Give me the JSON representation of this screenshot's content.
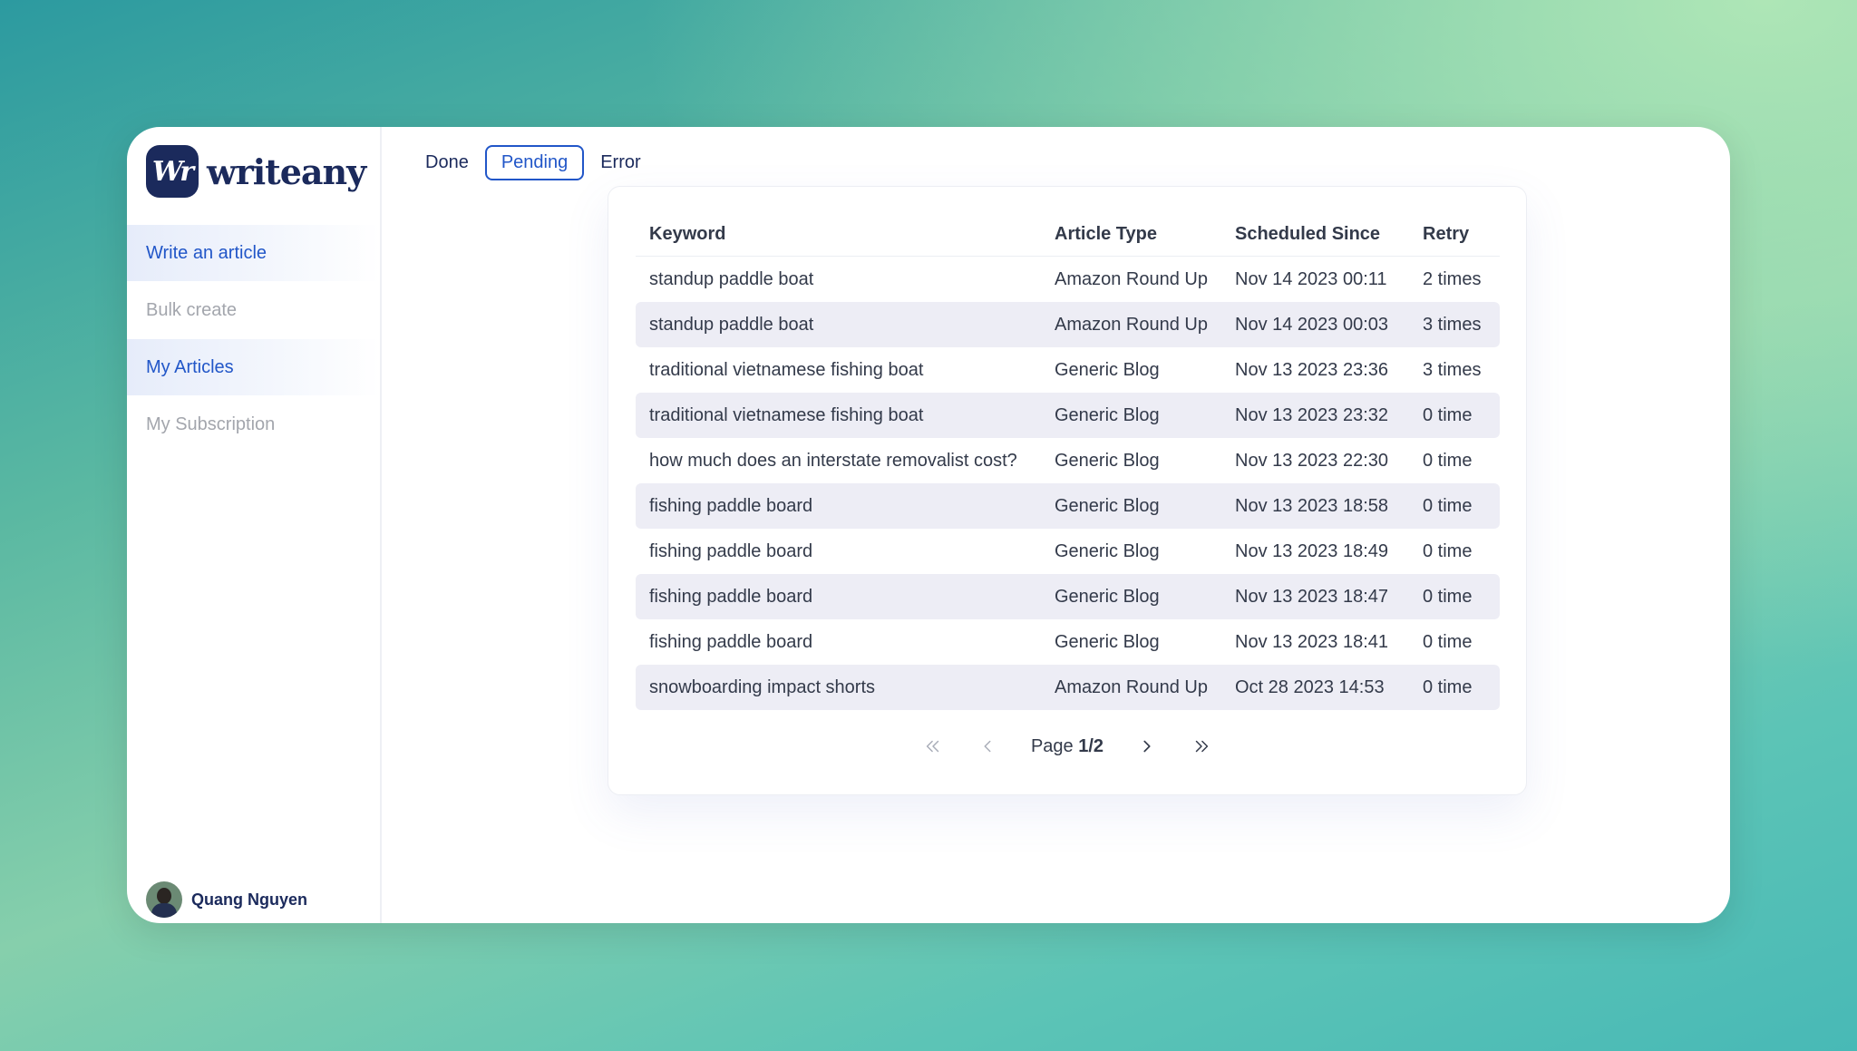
{
  "brand": {
    "mark": "Wr",
    "name": "writeany"
  },
  "sidebar": {
    "items": [
      {
        "label": "Write an article",
        "active": true
      },
      {
        "label": "Bulk create",
        "active": false
      },
      {
        "label": "My Articles",
        "active": true
      },
      {
        "label": "My Subscription",
        "active": false
      }
    ],
    "user": {
      "name": "Quang Nguyen"
    }
  },
  "tabs": [
    {
      "label": "Done",
      "active": false
    },
    {
      "label": "Pending",
      "active": true
    },
    {
      "label": "Error",
      "active": false
    }
  ],
  "table": {
    "headers": [
      "Keyword",
      "Article Type",
      "Scheduled Since",
      "Retry"
    ],
    "rows": [
      [
        "standup paddle boat",
        "Amazon Round Up",
        "Nov 14 2023 00:11",
        "2 times"
      ],
      [
        "standup paddle boat",
        "Amazon Round Up",
        "Nov 14 2023 00:03",
        "3 times"
      ],
      [
        "traditional vietnamese fishing boat",
        "Generic Blog",
        "Nov 13 2023 23:36",
        "3 times"
      ],
      [
        "traditional vietnamese fishing boat",
        "Generic Blog",
        "Nov 13 2023 23:32",
        "0 time"
      ],
      [
        "how much does an interstate removalist cost?",
        "Generic Blog",
        "Nov 13 2023 22:30",
        "0 time"
      ],
      [
        "fishing paddle board",
        "Generic Blog",
        "Nov 13 2023 18:58",
        "0 time"
      ],
      [
        "fishing paddle board",
        "Generic Blog",
        "Nov 13 2023 18:49",
        "0 time"
      ],
      [
        "fishing paddle board",
        "Generic Blog",
        "Nov 13 2023 18:47",
        "0 time"
      ],
      [
        "fishing paddle board",
        "Generic Blog",
        "Nov 13 2023 18:41",
        "0 time"
      ],
      [
        "snowboarding impact shorts",
        "Amazon Round Up",
        "Oct 28 2023 14:53",
        "0 time"
      ]
    ]
  },
  "pagination": {
    "prefix": "Page",
    "current": "1/2"
  },
  "colors": {
    "accent": "#2156c8",
    "brand": "#1b2a5c",
    "stripe": "#ededf5"
  }
}
